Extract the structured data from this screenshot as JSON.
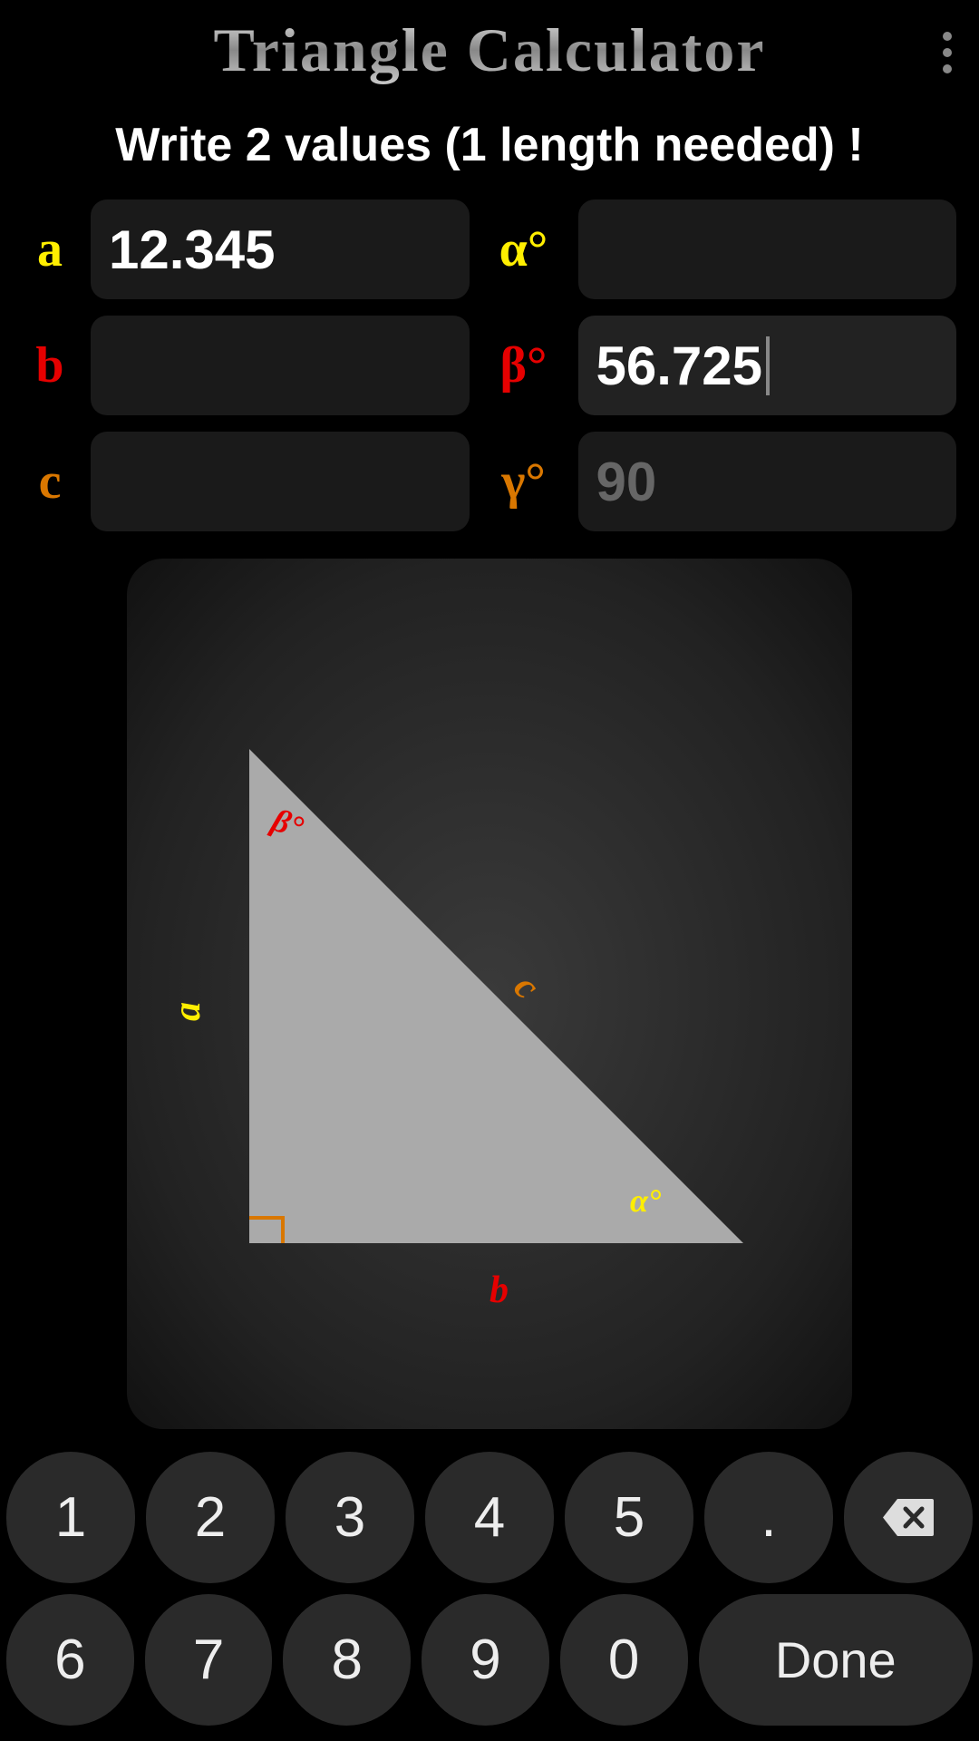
{
  "header": {
    "title": "Triangle Calculator"
  },
  "instruction": "Write 2 values (1 length needed) !",
  "inputs": {
    "a": {
      "label": "a",
      "value": "12.345"
    },
    "b": {
      "label": "b",
      "value": ""
    },
    "c": {
      "label": "c",
      "value": ""
    },
    "alpha": {
      "label": "α°",
      "value": ""
    },
    "beta": {
      "label": "β°",
      "value": "56.725"
    },
    "gamma": {
      "label": "γ°",
      "value": "",
      "placeholder": "90"
    }
  },
  "diagram": {
    "side_a": "a",
    "side_b": "b",
    "side_c": "c",
    "angle_alpha": "α°",
    "angle_beta": "β°"
  },
  "keypad": {
    "k1": "1",
    "k2": "2",
    "k3": "3",
    "k4": "4",
    "k5": "5",
    "k6": "6",
    "k7": "7",
    "k8": "8",
    "k9": "9",
    "k0": "0",
    "dot": ".",
    "done": "Done"
  },
  "colors": {
    "yellow": "#ffee00",
    "red": "#e60000",
    "orange": "#d97700"
  }
}
